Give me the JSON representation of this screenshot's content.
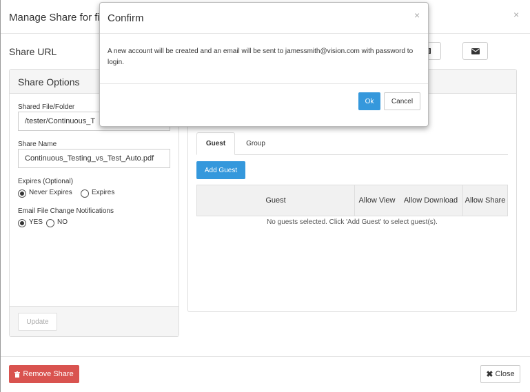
{
  "modal": {
    "title": "Manage Share for fi",
    "share_url_label": "Share URL",
    "close_x": "×"
  },
  "share_options": {
    "heading": "Share Options",
    "shared_file_label": "Shared File/Folder",
    "shared_file_value": "/tester/Continuous_T",
    "share_name_label": "Share Name",
    "share_name_value": "Continuous_Testing_vs_Test_Auto.pdf",
    "expires_label": "Expires (Optional)",
    "never_expires": "Never Expires",
    "expires": "Expires",
    "expires_selected": "Never Expires",
    "notify_label": "Email File Change Notifications",
    "yes": "YES",
    "no": "NO",
    "notify_selected": "YES",
    "update_button": "Update"
  },
  "recipients": {
    "tabs": [
      "Guest",
      "Group"
    ],
    "active_tab": "Guest",
    "add_guest_button": "Add Guest",
    "columns": [
      "Guest",
      "Allow View",
      "Allow Download",
      "Allow Share"
    ],
    "empty_message": "No guests selected. Click 'Add Guest' to select guest(s)."
  },
  "footer": {
    "remove_share": "Remove Share",
    "close": "Close"
  },
  "confirm": {
    "title": "Confirm",
    "message": "A new account will be created and an email will be sent to jamessmith@vision.com with password to login.",
    "ok": "Ok",
    "cancel": "Cancel",
    "close_x": "×"
  },
  "icons": {
    "copy": "copy-icon",
    "email": "envelope-icon",
    "trash": "trash-icon",
    "close": "close-icon"
  },
  "colors": {
    "primary": "#3598dc",
    "danger": "#d9534f"
  }
}
